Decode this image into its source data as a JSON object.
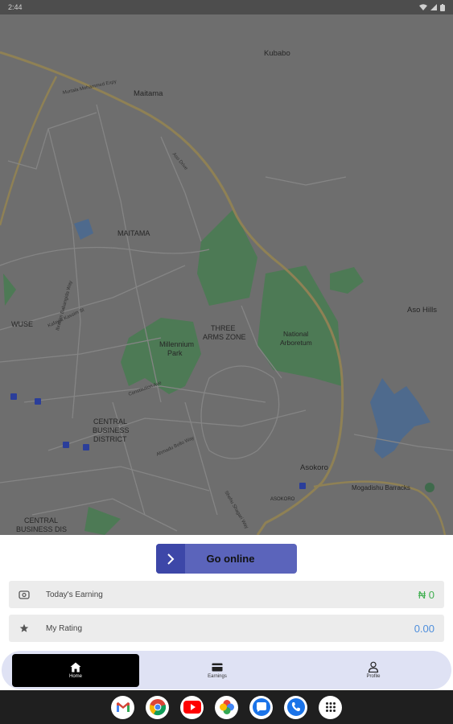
{
  "status_bar": {
    "time": "2:44"
  },
  "map": {
    "places": [
      {
        "id": "kubabo",
        "text": "Kubabo"
      },
      {
        "id": "maitama-area",
        "text": "Maitama"
      },
      {
        "id": "maitama-district",
        "text": "MAITAMA"
      },
      {
        "id": "wuse",
        "text": "WUSE"
      },
      {
        "id": "millennium-park-1",
        "text": "Millennium"
      },
      {
        "id": "millennium-park-2",
        "text": "Park"
      },
      {
        "id": "three-arms-1",
        "text": "THREE"
      },
      {
        "id": "three-arms-2",
        "text": "ARMS ZONE"
      },
      {
        "id": "national-arboretum-1",
        "text": "National"
      },
      {
        "id": "national-arboretum-2",
        "text": "Arboretum"
      },
      {
        "id": "cbd-1",
        "text": "CENTRAL"
      },
      {
        "id": "cbd-2",
        "text": "BUSINESS"
      },
      {
        "id": "cbd-3",
        "text": "DISTRICT"
      },
      {
        "id": "cbd-bottom-1",
        "text": "CENTRAL"
      },
      {
        "id": "cbd-bottom-2",
        "text": "BUSINESS DIS"
      },
      {
        "id": "asokoro",
        "text": "Asokoro"
      },
      {
        "id": "aso-hills",
        "text": "Aso Hills"
      },
      {
        "id": "mogadishu-barracks",
        "text": "Mogadishu Barracks"
      },
      {
        "id": "asokoro-small",
        "text": "ASOKORO"
      }
    ],
    "streets": [
      {
        "id": "s1",
        "text": "Murtala Mohammed Expy"
      },
      {
        "id": "s2",
        "text": "Aso Drive"
      },
      {
        "id": "s3",
        "text": "Kafayat Kassim St"
      },
      {
        "id": "s4",
        "text": "Constitution Ave"
      },
      {
        "id": "s5",
        "text": "Shehu Shagari Way"
      },
      {
        "id": "s6",
        "text": "Ahmadu Bello Way"
      },
      {
        "id": "s7",
        "text": "Ibrahim Babangida Way"
      }
    ]
  },
  "go_online": {
    "label": "Go online"
  },
  "earning": {
    "label": "Today's Earning",
    "value": "₦ 0",
    "value_color": "#3fae4f"
  },
  "rating": {
    "label": "My Rating",
    "value": "0.00",
    "value_color": "#4f8fdc"
  },
  "nav": {
    "items": [
      {
        "label": "Home",
        "icon": "home-icon"
      },
      {
        "label": "Earnings",
        "icon": "card-icon"
      },
      {
        "label": "Profile",
        "icon": "person-icon"
      }
    ]
  },
  "dock": {
    "apps": [
      "gmail-icon",
      "chrome-icon",
      "youtube-icon",
      "photos-icon",
      "messages-icon",
      "phone-icon",
      "apps-grid-icon"
    ]
  }
}
